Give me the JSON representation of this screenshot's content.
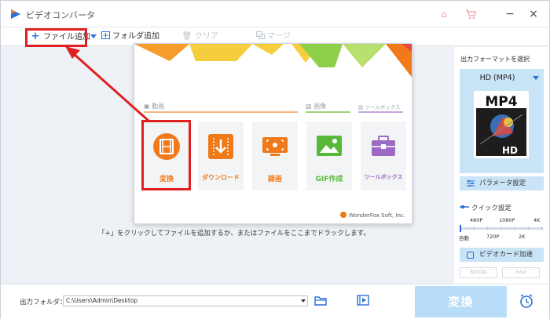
{
  "window": {
    "title": "ビデオコンバータ",
    "minimize_glyph": "−",
    "close_glyph": "×"
  },
  "toolbar": {
    "add_file": "ファイル追加",
    "add_folder": "フォルダ追加",
    "clear": "クリア",
    "merge": "マージ"
  },
  "popup": {
    "sections": {
      "video": "動画",
      "image": "画像",
      "toolbox": "ツールボックス"
    },
    "cards": [
      {
        "label": "変換",
        "color": "#f07a1a"
      },
      {
        "label": "ダウンロード",
        "color": "#f07a1a"
      },
      {
        "label": "録画",
        "color": "#f07a1a"
      },
      {
        "label": "GIF作成",
        "color": "#57b83a"
      },
      {
        "label": "ツールボックス",
        "color": "#9b6bc4"
      }
    ],
    "brand": "WonderFox Soft, Inc."
  },
  "main": {
    "hint": "「+」をクリックしてファイルを追加するか、またはファイルをここまでドラックします。"
  },
  "right_panel": {
    "title": "出力フォーマットを選択",
    "format_name": "HD (MP4)",
    "format_icon_top": "MP4",
    "format_icon_bottom": "HD",
    "param_button": "パラメータ設定",
    "quick_label": "クイック設定",
    "slider_top": [
      "480P",
      "1080P",
      "4K"
    ],
    "slider_bottom": [
      "自動",
      "720P",
      "2K"
    ],
    "slider_level": 0.0,
    "gpu_button": "ビデオカード加速",
    "gpu_brands": [
      "NVIDIA",
      "Intel"
    ]
  },
  "bottom": {
    "output_label": "出力フォルダ：",
    "output_path": "C:\\Users\\Admin\\Desktop",
    "convert_button": "変換"
  },
  "colors": {
    "accent_blue": "#2a6fd6",
    "highlight_red": "#e02020",
    "panel_blue": "#c9e3f7",
    "convert_disabled": "#b7ddf8"
  }
}
